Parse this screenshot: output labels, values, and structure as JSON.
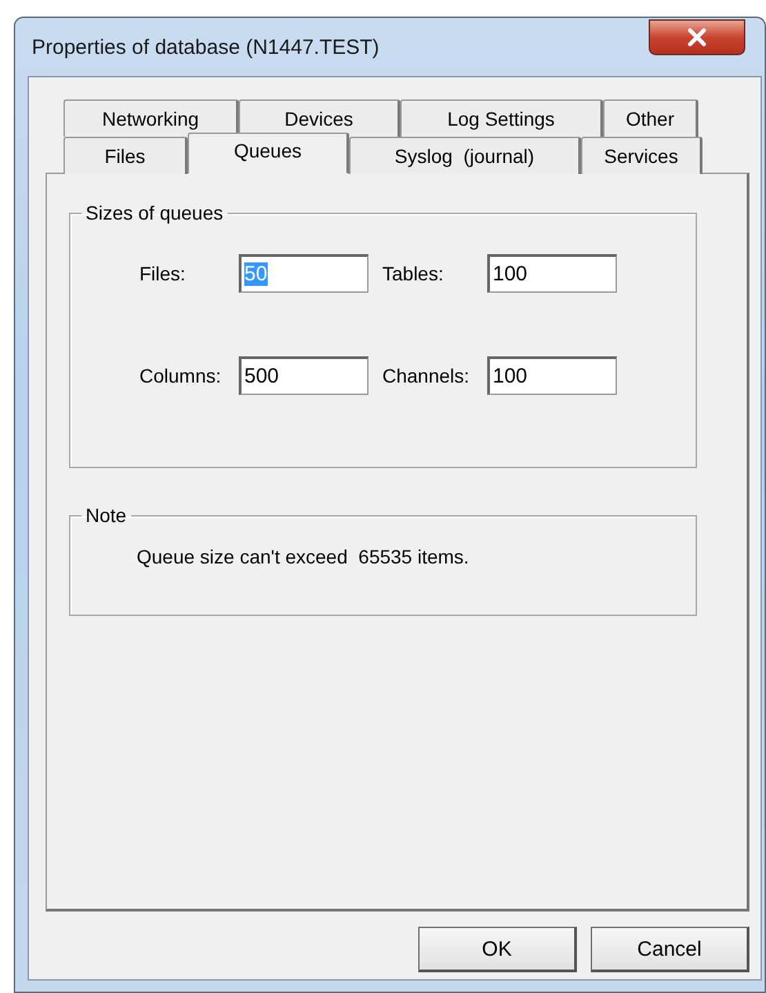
{
  "window": {
    "title": "Properties of database (N1447.TEST)"
  },
  "tab_rows": [
    [
      {
        "label": "Networking",
        "selected": false
      },
      {
        "label": "Devices",
        "selected": false
      },
      {
        "label": "Log Settings",
        "selected": false
      },
      {
        "label": "Other",
        "selected": false
      }
    ],
    [
      {
        "label": "Files",
        "selected": false
      },
      {
        "label": "Queues",
        "selected": true
      },
      {
        "label": "Syslog  (journal)",
        "selected": false
      },
      {
        "label": "Services",
        "selected": false
      }
    ]
  ],
  "sizes_group": {
    "title": "Sizes of queues",
    "fields": [
      {
        "label": "Files:",
        "value": "50",
        "text_selected": true
      },
      {
        "label": "Tables:",
        "value": "100",
        "text_selected": false
      },
      {
        "label": "Columns:",
        "value": "500",
        "text_selected": false
      },
      {
        "label": "Channels:",
        "value": "100",
        "text_selected": false
      }
    ]
  },
  "note_group": {
    "title": "Note",
    "text": "Queue size can't exceed  65535 items."
  },
  "buttons": [
    "OK",
    "Cancel"
  ]
}
